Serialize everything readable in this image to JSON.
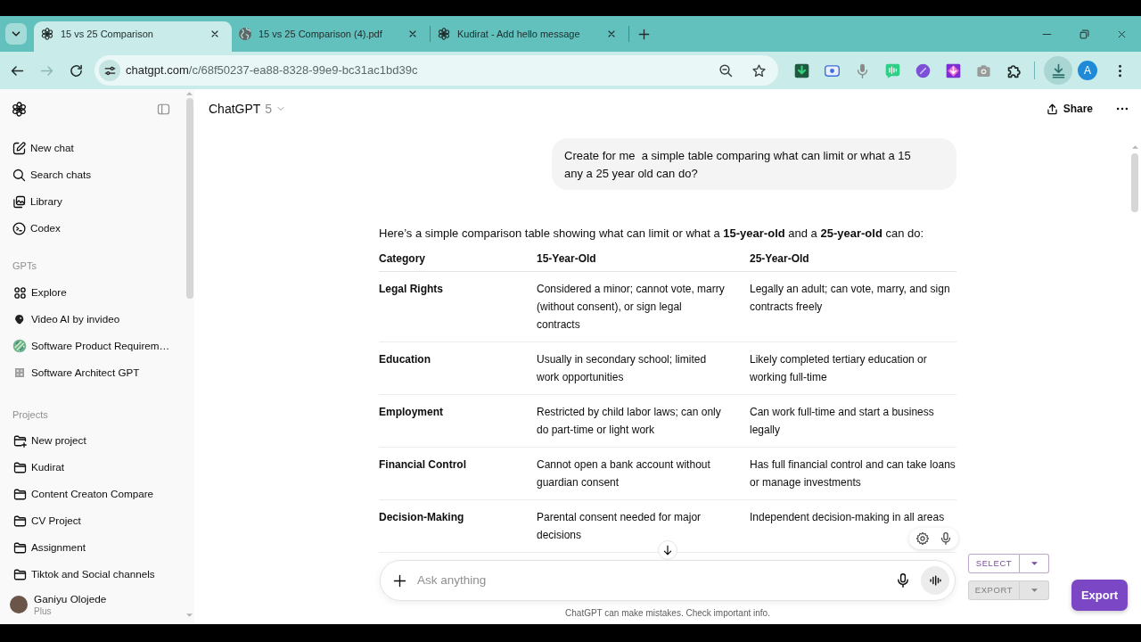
{
  "browser": {
    "tabs": [
      {
        "title": "15 vs 25 Comparison",
        "kind": "app",
        "selected": true
      },
      {
        "title": "15 vs 25 Comparison (4).pdf",
        "kind": "web",
        "selected": false
      },
      {
        "title": "Kudirat - Add hello message",
        "kind": "app",
        "selected": false
      }
    ],
    "forward": {
      "disabled": true
    },
    "address": {
      "domain": "chatgpt.com",
      "path": "/c/68f50237-ea88-8328-99e9-bc31ac1bd39c"
    },
    "download_button": {
      "highlighted": true
    },
    "profile": {
      "initial": "A"
    }
  },
  "sidebar": {
    "items": [
      {
        "label": "New chat"
      },
      {
        "label": "Search chats"
      },
      {
        "label": "Library"
      },
      {
        "label": "Codex"
      }
    ],
    "sections": [
      {
        "heading": "GPTs",
        "items": [
          {
            "label": "Explore"
          },
          {
            "label": "Video AI by invideo"
          },
          {
            "label": "Software Product Requirem…"
          },
          {
            "label": "Software Architect GPT"
          }
        ]
      },
      {
        "heading": "Projects",
        "items": [
          {
            "label": "New project",
            "kind": "create"
          },
          {
            "label": "Kudirat",
            "kind": "project"
          },
          {
            "label": "Content Creaton Compare",
            "kind": "project"
          },
          {
            "label": "CV Project",
            "kind": "project"
          },
          {
            "label": "Assignment",
            "kind": "project"
          },
          {
            "label": "Tiktok and Social channels",
            "kind": "project"
          }
        ]
      }
    ],
    "user": {
      "name": "Ganiyu Olojede",
      "plan": "Plus"
    }
  },
  "header": {
    "model": "ChatGPT",
    "version": "5",
    "share": "Share"
  },
  "chat": {
    "user_message": "Create for me  a simple table comparing what can limit or what a 15 any a 25 year old can do?",
    "intro": "Here’s a simple comparison table showing what can limit or what a **15-year-old** and a **25-year-old** can do:",
    "table": {
      "columns": [
        "Category",
        "15-Year-Old",
        "25-Year-Old"
      ],
      "rows": [
        [
          "Legal Rights",
          "Considered a minor; cannot vote, marry (without consent), or sign legal contracts",
          "Legally an adult; can vote, marry, and sign contracts freely"
        ],
        [
          "Education",
          "Usually in secondary school; limited work opportunities",
          "Likely completed tertiary education or working full-time"
        ],
        [
          "Employment",
          "Restricted by child labor laws; can only do part-time or light work",
          "Can work full-time and start a business legally"
        ],
        [
          "Financial Control",
          "Cannot open a bank account without guardian consent",
          "Has full financial control and can take loans or manage investments"
        ],
        [
          "Decision-Making",
          "Parental consent needed for major decisions",
          "Independent decision-making in all areas"
        ]
      ]
    }
  },
  "composer": {
    "placeholder": "Ask anything",
    "disclaimer": "ChatGPT can make mistakes. Check important info."
  },
  "export_tools": {
    "select": {
      "label": "SELECT",
      "disabled": false
    },
    "export_menu": {
      "label": "EXPORT",
      "disabled": true
    },
    "export_button": "Export"
  }
}
